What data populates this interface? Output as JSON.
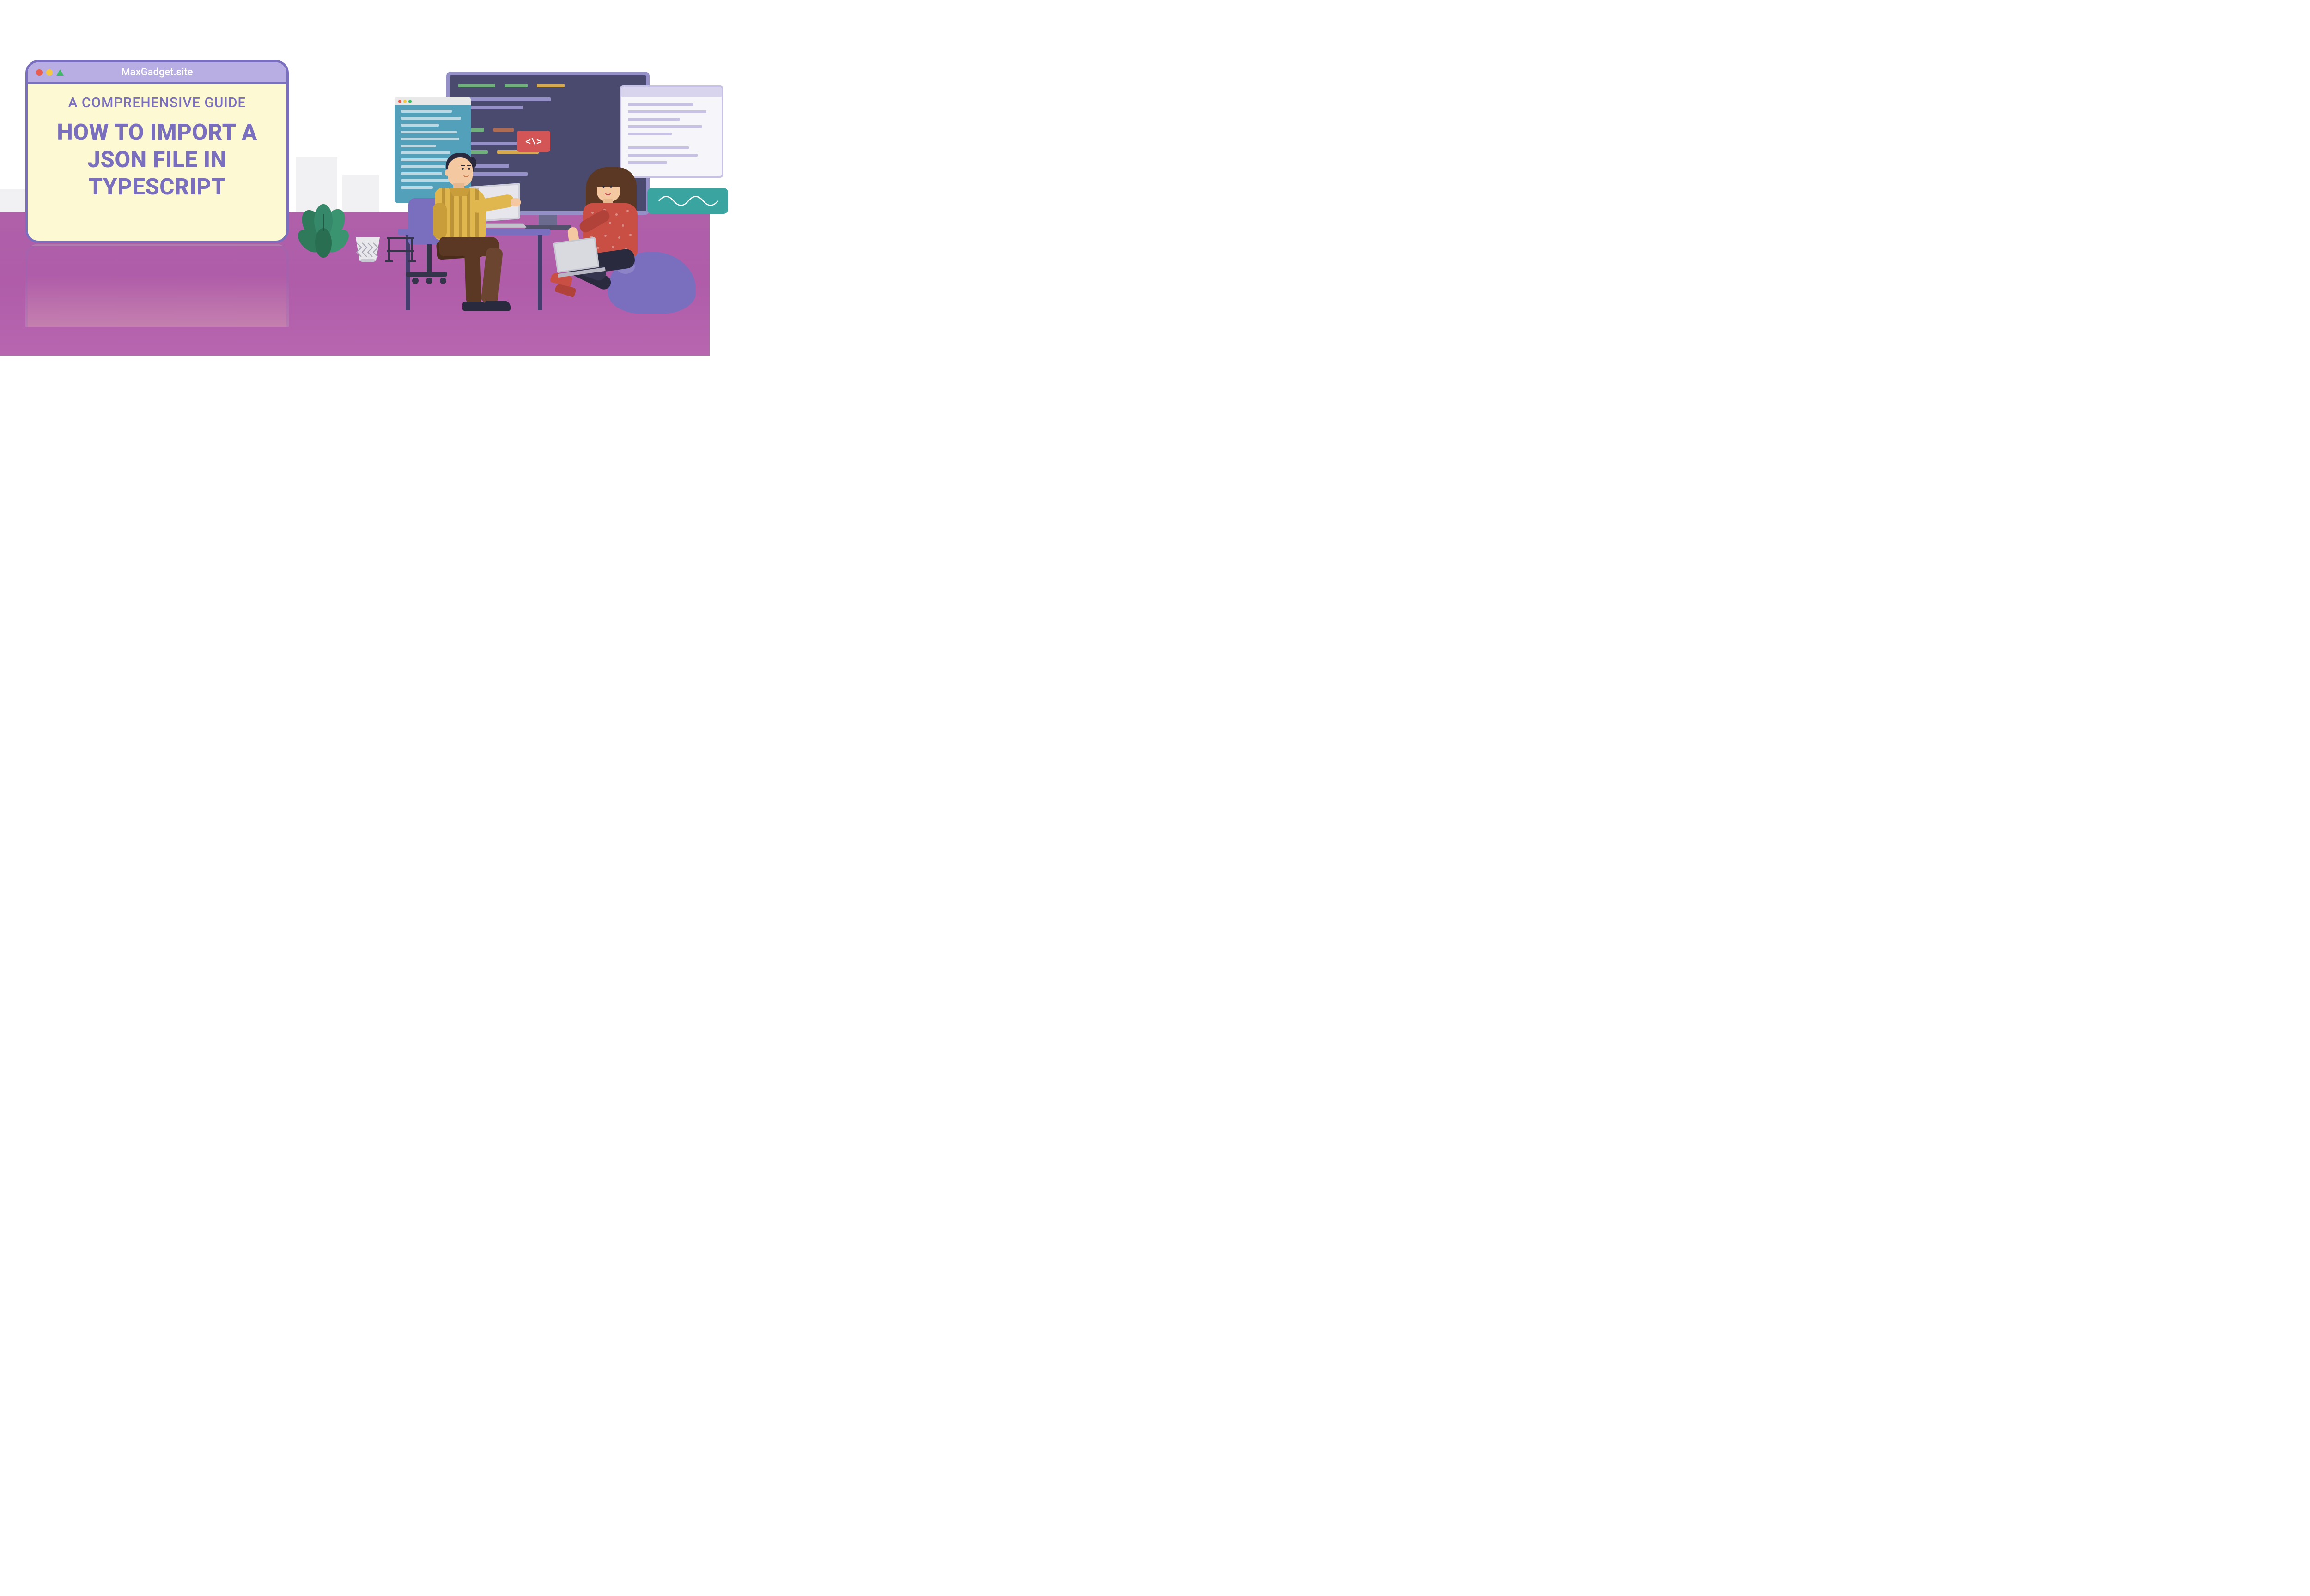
{
  "card": {
    "site_name": "MaxGadget.site",
    "subtitle": "A COMPREHENSIVE GUIDE",
    "title": "HOW TO IMPORT A JSON FILE IN TYPESCRIPT"
  },
  "code_badge": "<\\>",
  "colors": {
    "primary_purple": "#7a6fbf",
    "accent_cream": "#fdf9d2",
    "floor_magenta": "#a853a2",
    "red": "#e85d4f",
    "yellow": "#f5c842",
    "green": "#3fb968",
    "teal": "#3aa5a0",
    "code_red": "#d45555"
  }
}
